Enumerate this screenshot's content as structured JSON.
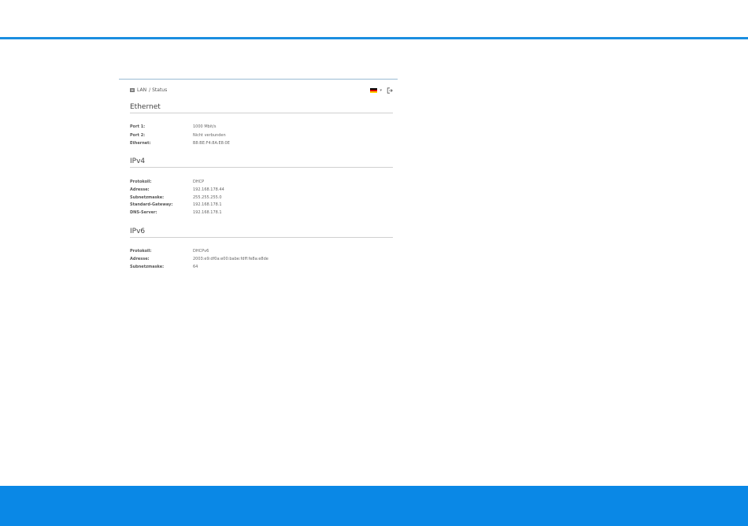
{
  "breadcrumb": {
    "section": "LAN",
    "separator": "/",
    "page": "Status"
  },
  "language": {
    "flag_colors": [
      "#000000",
      "#dd0000",
      "#ffce00"
    ],
    "chevron": "▾"
  },
  "icons": {
    "lan": "network-icon",
    "language": "german-flag-icon",
    "logout": "logout-icon"
  },
  "colors": {
    "accent": "#0a88e6",
    "top_line": "#1a8ee0"
  },
  "sections": {
    "ethernet": {
      "title": "Ethernet",
      "rows": [
        {
          "label": "Port 1:",
          "value": "1000 Mbit/s"
        },
        {
          "label": "Port 2:",
          "value": "Nicht verbunden"
        },
        {
          "label": "Ethernet:",
          "value": "B8:BE:F4:8A:E8:0E"
        }
      ]
    },
    "ipv4": {
      "title": "IPv4",
      "rows": [
        {
          "label": "Protokoll:",
          "value": "DHCP"
        },
        {
          "label": "Adresse:",
          "value": "192.168.178.44"
        },
        {
          "label": "Subnetzmaske:",
          "value": "255.255.255.0"
        },
        {
          "label": "Standard-Gateway:",
          "value": "192.168.178.1"
        },
        {
          "label": "DNS-Server:",
          "value": "192.168.178.1"
        }
      ]
    },
    "ipv6": {
      "title": "IPv6",
      "rows": [
        {
          "label": "Protokoll:",
          "value": "DHCPv6"
        },
        {
          "label": "Adresse:",
          "value": "2003:e9:df0a:e00:babe:fdff:fe8a:e8de"
        },
        {
          "label": "Subnetzmaske:",
          "value": "64"
        }
      ]
    }
  }
}
